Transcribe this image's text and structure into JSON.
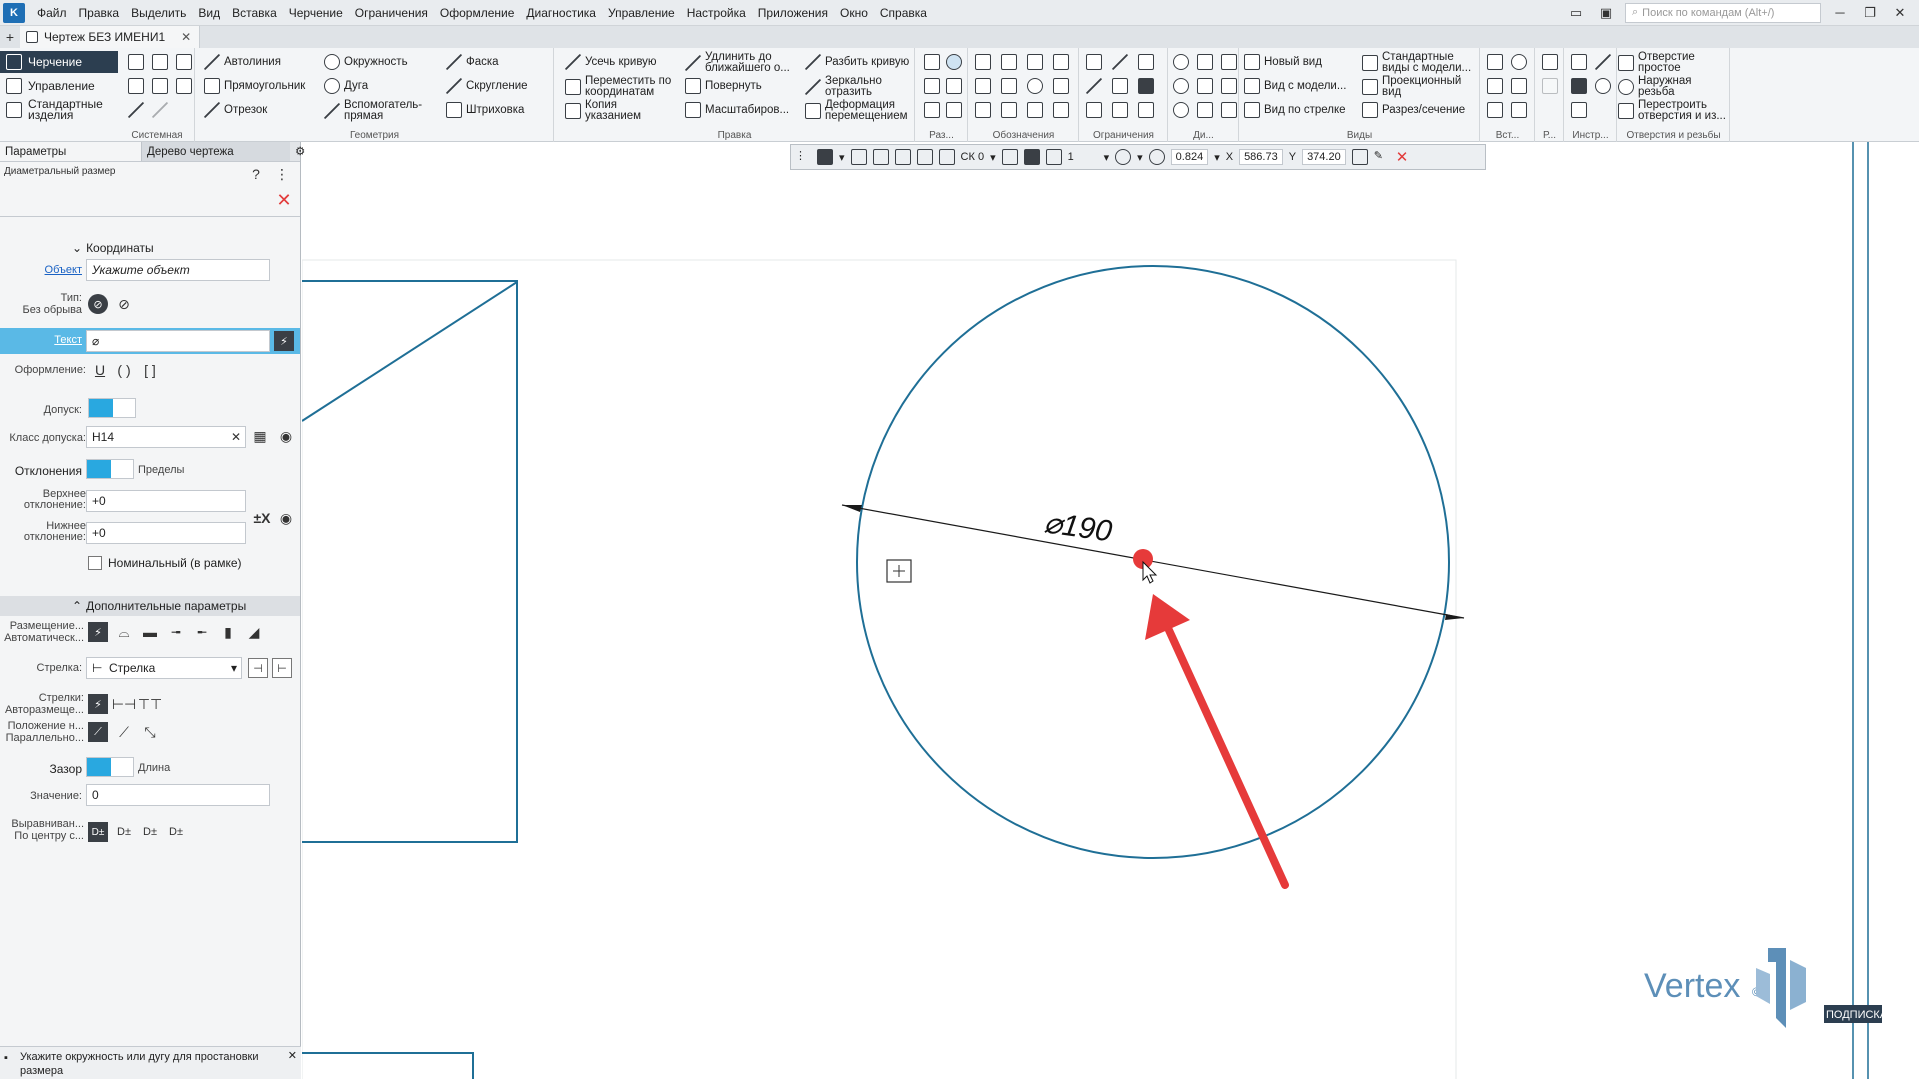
{
  "menu": {
    "items": [
      "Файл",
      "Правка",
      "Выделить",
      "Вид",
      "Вставка",
      "Черчение",
      "Ограничения",
      "Оформление",
      "Диагностика",
      "Управление",
      "Настройка",
      "Приложения",
      "Окно",
      "Справка"
    ],
    "search_placeholder": "Поиск по командам (Alt+/)"
  },
  "tabbar": {
    "doc_tab": "Чертеж БЕЗ ИМЕНИ1"
  },
  "modes": [
    "Черчение",
    "Управление",
    "Стандартные изделия"
  ],
  "ribbon": {
    "groups": {
      "system": "Системная",
      "geometry": "Геометрия",
      "edit": "Правка",
      "dims": "Раз...",
      "marks": "Обозначения",
      "constraints": "Ограничения",
      "di": "Ди...",
      "views": "Виды",
      "insert": "Вст...",
      "r": "Р...",
      "instr": "Инстр...",
      "holes": "Отверстия и резьбы"
    },
    "geometry": [
      "Автолиния",
      "Прямоугольник",
      "Отрезок",
      "Окружность",
      "Дуга",
      "Вспомогатель- прямая",
      "Фаска",
      "Скругление",
      "Штриховка"
    ],
    "edit": [
      "Усечь кривую",
      "Переместить по координатам",
      "Копия указанием",
      "Удлинить до ближайшего о...",
      "Повернуть",
      "Масштабиров...",
      "Разбить кривую",
      "Зеркально отразить",
      "Деформация перемещением"
    ],
    "views": [
      "Новый вид",
      "Вид с модели...",
      "Вид по стрелке",
      "Стандартные виды с модели...",
      "Проекционный вид",
      "Разрез/сечение"
    ],
    "holes": [
      "Отверстие простое",
      "Наружная резьба",
      "Перестроить отверстия и из..."
    ]
  },
  "panel": {
    "tab_params": "Параметры",
    "tab_tree": "Дерево чертежа",
    "command": "Диаметральный размер",
    "section_coords": "Координаты",
    "object_label": "Объект",
    "object_value": "Укажите объект",
    "type_label": "Тип:",
    "type_sub": "Без обрыва",
    "text_label": "Текст",
    "text_value": "⌀",
    "format_label": "Оформление:",
    "format_opts": [
      "U",
      "( )",
      "[ ]"
    ],
    "tolerance_label": "Допуск:",
    "tol_class_label": "Класс допуска:",
    "tol_class_value": "H14",
    "deviations_label": "Отклонения",
    "limits_label": "Пределы",
    "upper_label": "Верхнее отклонение:",
    "upper_value": "+0",
    "lower_label": "Нижнее отклонение:",
    "lower_value": "+0",
    "nominal_label": "Номинальный (в рамке)",
    "section_extra": "Дополнительные параметры",
    "placement_label": "Размещение...",
    "placement_sub": "Автоматическ...",
    "arrow_label": "Стрелка:",
    "arrow_value": "Стрелка",
    "arrows_label": "Стрелки:",
    "arrows_sub": "Авторазмеще...",
    "position_label": "Положение н...",
    "position_sub": "Параллельно...",
    "gap_label": "Зазор",
    "length_label": "Длина",
    "value_label": "Значение:",
    "value_value": "0",
    "align_label": "Выравниван...",
    "align_sub": "По центру с...",
    "align_opts": [
      "D±",
      "D±",
      "D±",
      "D±"
    ]
  },
  "float_toolbar": {
    "cs": "СК 0",
    "layer": "1",
    "zoom": "0.824",
    "x_label": "X",
    "x": "586.73",
    "y_label": "Y",
    "y": "374.20"
  },
  "hint": "Укажите окружность или дугу для простановки размера",
  "drawing": {
    "dimension_text": "⌀190",
    "diameter": 190
  },
  "brand": {
    "name": "Vertex",
    "tag": "ПОДПИСКА"
  },
  "colors": {
    "accent": "#29a8e0",
    "circle": "#1f6f96",
    "arrow": "#e63a3a",
    "brand": "#5d8fb8"
  }
}
